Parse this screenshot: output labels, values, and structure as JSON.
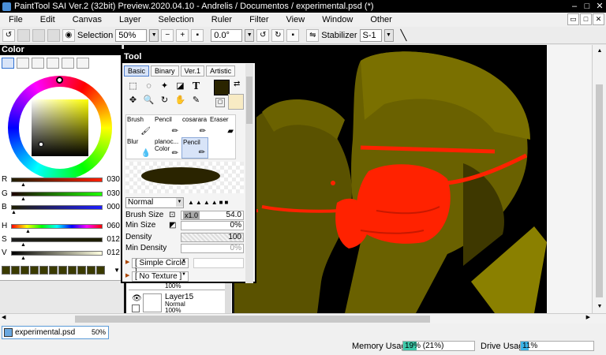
{
  "window": {
    "title": "PaintTool SAI Ver.2 (32bit) Preview.2020.04.10 - Andrelis / Documentos / experimental.psd (*)"
  },
  "menu": [
    "File",
    "Edit",
    "Canvas",
    "Layer",
    "Selection",
    "Ruler",
    "Filter",
    "View",
    "Window",
    "Other"
  ],
  "toolbar": {
    "selection_label": "Selection",
    "zoom_value": "50%",
    "rotation_value": "0.0°",
    "stabilizer_label": "Stabilizer",
    "stabilizer_value": "S-1"
  },
  "color_panel": {
    "title": "Color",
    "accent": "#ffff00",
    "sliders": [
      {
        "label": "R",
        "value": "030"
      },
      {
        "label": "G",
        "value": "030"
      },
      {
        "label": "B",
        "value": "000"
      },
      {
        "label": "H",
        "value": "060"
      },
      {
        "label": "S",
        "value": "012"
      },
      {
        "label": "V",
        "value": "012"
      }
    ]
  },
  "tool_panel": {
    "title": "Tool",
    "tabs": [
      "Basic",
      "Binary",
      "Ver.1",
      "Artistic"
    ],
    "fg_color": "#2a2400",
    "bg_color": "#f8ebc4",
    "brushes": [
      {
        "name": "Brush",
        "icon": "brush-icon"
      },
      {
        "name": "Pencil",
        "icon": "pencil-icon"
      },
      {
        "name": "cosarara",
        "icon": "pencil-icon"
      },
      {
        "name": "Eraser",
        "icon": "eraser-icon"
      },
      {
        "name": "Blur",
        "icon": "droplet-icon"
      },
      {
        "name": "planoc... Color",
        "icon": "pencil-icon"
      },
      {
        "name": "Pencil",
        "icon": "pencil-icon",
        "selected": true
      }
    ],
    "blend_mode": "Normal",
    "brush_size_label": "Brush Size",
    "brush_size_multiplier": "x1.0",
    "brush_size_value": "54.0",
    "min_size_label": "Min Size",
    "min_size_value": "0%",
    "density_label": "Density",
    "density_value": "100",
    "min_density_label": "Min Density",
    "min_density_value": "0%",
    "shape_value": "[ Simple Circle ]",
    "texture_value": "[ No Texture ]"
  },
  "layers": {
    "items": [
      {
        "name": "",
        "mode": "",
        "opacity": "100%"
      },
      {
        "name": "Layer15",
        "mode": "Normal",
        "opacity": "100%"
      }
    ]
  },
  "status": {
    "doc_name": "experimental.psd",
    "doc_zoom": "50%",
    "memory_label": "Memory Usage",
    "memory_value": "19% (21%)",
    "memory_fraction": 0.19,
    "drive_label": "Drive Usage",
    "drive_value": "11%",
    "drive_fraction": 0.11
  }
}
